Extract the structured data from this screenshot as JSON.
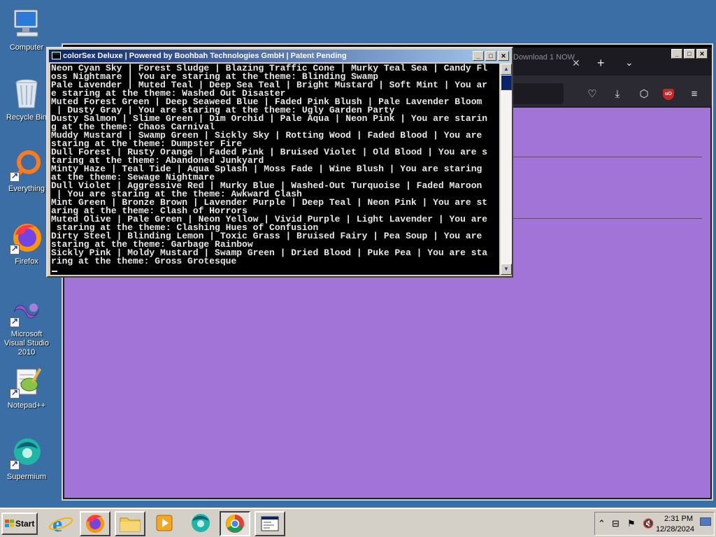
{
  "desktop": {
    "icons": [
      {
        "label": "Computer"
      },
      {
        "label": "Recycle Bin"
      },
      {
        "label": "Everything"
      },
      {
        "label": "Firefox"
      },
      {
        "label": "Microsoft Visual Studio 2010"
      },
      {
        "label": "Notepad++"
      },
      {
        "label": "Supermium"
      }
    ],
    "background_color": "#3a6ea5"
  },
  "browser": {
    "tab_title": "Download 1 NOW",
    "content_background": "#a274d8",
    "ublock_badge": "uO"
  },
  "console": {
    "title": "colorSex Deluxe | Powered by Boohbah Technologies GmbH | Patent Pending",
    "lines": [
      "Neon Cyan Sky | Forest Sludge | Blazing Traffic Cone | Murky Teal Sea | Candy Fl",
      "oss Nightmare | You are staring at the theme: Blinding Swamp",
      "Pale Lavender | Muted Teal | Deep Sea Teal | Bright Mustard | Soft Mint | You ar",
      "e staring at the theme: Washed Out Disaster",
      "Muted Forest Green | Deep Seaweed Blue | Faded Pink Blush | Pale Lavender Bloom",
      " | Dusty Gray | You are staring at the theme: Ugly Garden Party",
      "Dusty Salmon | Slime Green | Dim Orchid | Pale Aqua | Neon Pink | You are starin",
      "g at the theme: Chaos Carnival",
      "Muddy Mustard | Swamp Green | Sickly Sky | Rotting Wood | Faded Blood | You are",
      "staring at the theme: Dumpster Fire",
      "Dull Forest | Rusty Orange | Faded Pink | Bruised Violet | Old Blood | You are s",
      "taring at the theme: Abandoned Junkyard",
      "Minty Haze | Teal Tide | Aqua Splash | Moss Fade | Wine Blush | You are staring",
      "at the theme: Sewage Nightmare",
      "Dull Violet | Aggressive Red | Murky Blue | Washed-Out Turquoise | Faded Maroon",
      " | You are staring at the theme: Awkward Clash",
      "Mint Green | Bronze Brown | Lavender Purple | Deep Teal | Neon Pink | You are st",
      "aring at the theme: Clash of Horrors",
      "Muted Olive | Pale Green | Neon Yellow | Vivid Purple | Light Lavender | You are",
      " staring at the theme: Clashing Hues of Confusion",
      "Dirty Steel | Blinding Lemon | Toxic Grass | Bruised Fairy | Pea Soup | You are",
      "staring at the theme: Garbage Rainbow",
      "Sickly Pink | Moldy Mustard | Swamp Green | Dried Blood | Puke Pea | You are sta",
      "ring at the theme: Gross Grotesque"
    ]
  },
  "taskbar": {
    "start_label": "Start",
    "clock_time": "2:31 PM",
    "clock_date": "12/28/2024"
  }
}
